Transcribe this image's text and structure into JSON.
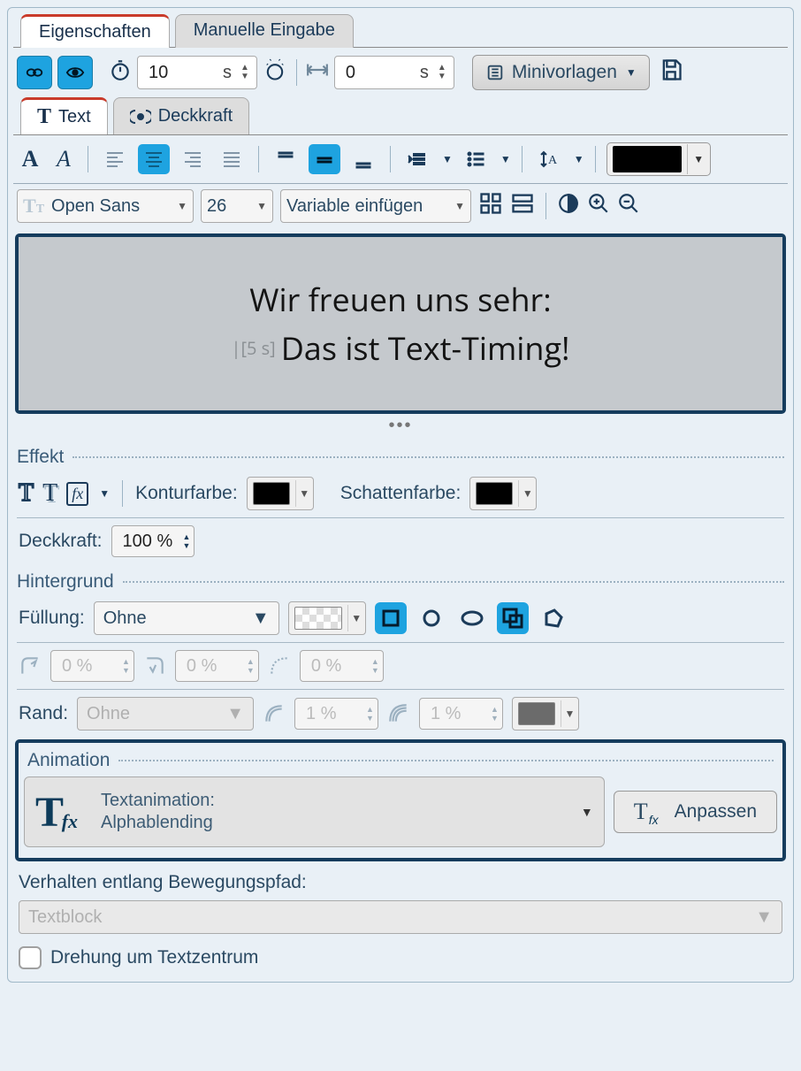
{
  "tabs": {
    "properties": "Eigenschaften",
    "manual": "Manuelle Eingabe"
  },
  "duration": {
    "value": "10",
    "unit": "s"
  },
  "duration2": {
    "value": "0",
    "unit": "s"
  },
  "templates_btn": "Minivorlagen",
  "subtabs": {
    "text": "Text",
    "opacity": "Deckkraft"
  },
  "font": {
    "family": "Open Sans",
    "size": "26",
    "insert_var": "Variable einfügen"
  },
  "preview": {
    "line1": "Wir freuen uns sehr:",
    "timing": "|[5 s]",
    "line2": "Das ist Text-Timing!"
  },
  "effekt": {
    "section": "Effekt",
    "contour": "Konturfarbe:",
    "shadow": "Schattenfarbe:",
    "opacity_label": "Deckkraft:",
    "opacity_value": "100 %"
  },
  "hintergrund": {
    "section": "Hintergrund",
    "fill_label": "Füllung:",
    "fill_value": "Ohne",
    "corner1": "0 %",
    "corner2": "0 %",
    "corner3": "0 %",
    "rand_label": "Rand:",
    "rand_value": "Ohne",
    "border1": "1 %",
    "border2": "1 %"
  },
  "animation": {
    "section": "Animation",
    "label1": "Textanimation:",
    "label2": "Alphablending",
    "adjust": "Anpassen"
  },
  "behavior_label": "Verhalten entlang Bewegungspfad:",
  "behavior_value": "Textblock",
  "rotate_label": "Drehung um Textzentrum"
}
